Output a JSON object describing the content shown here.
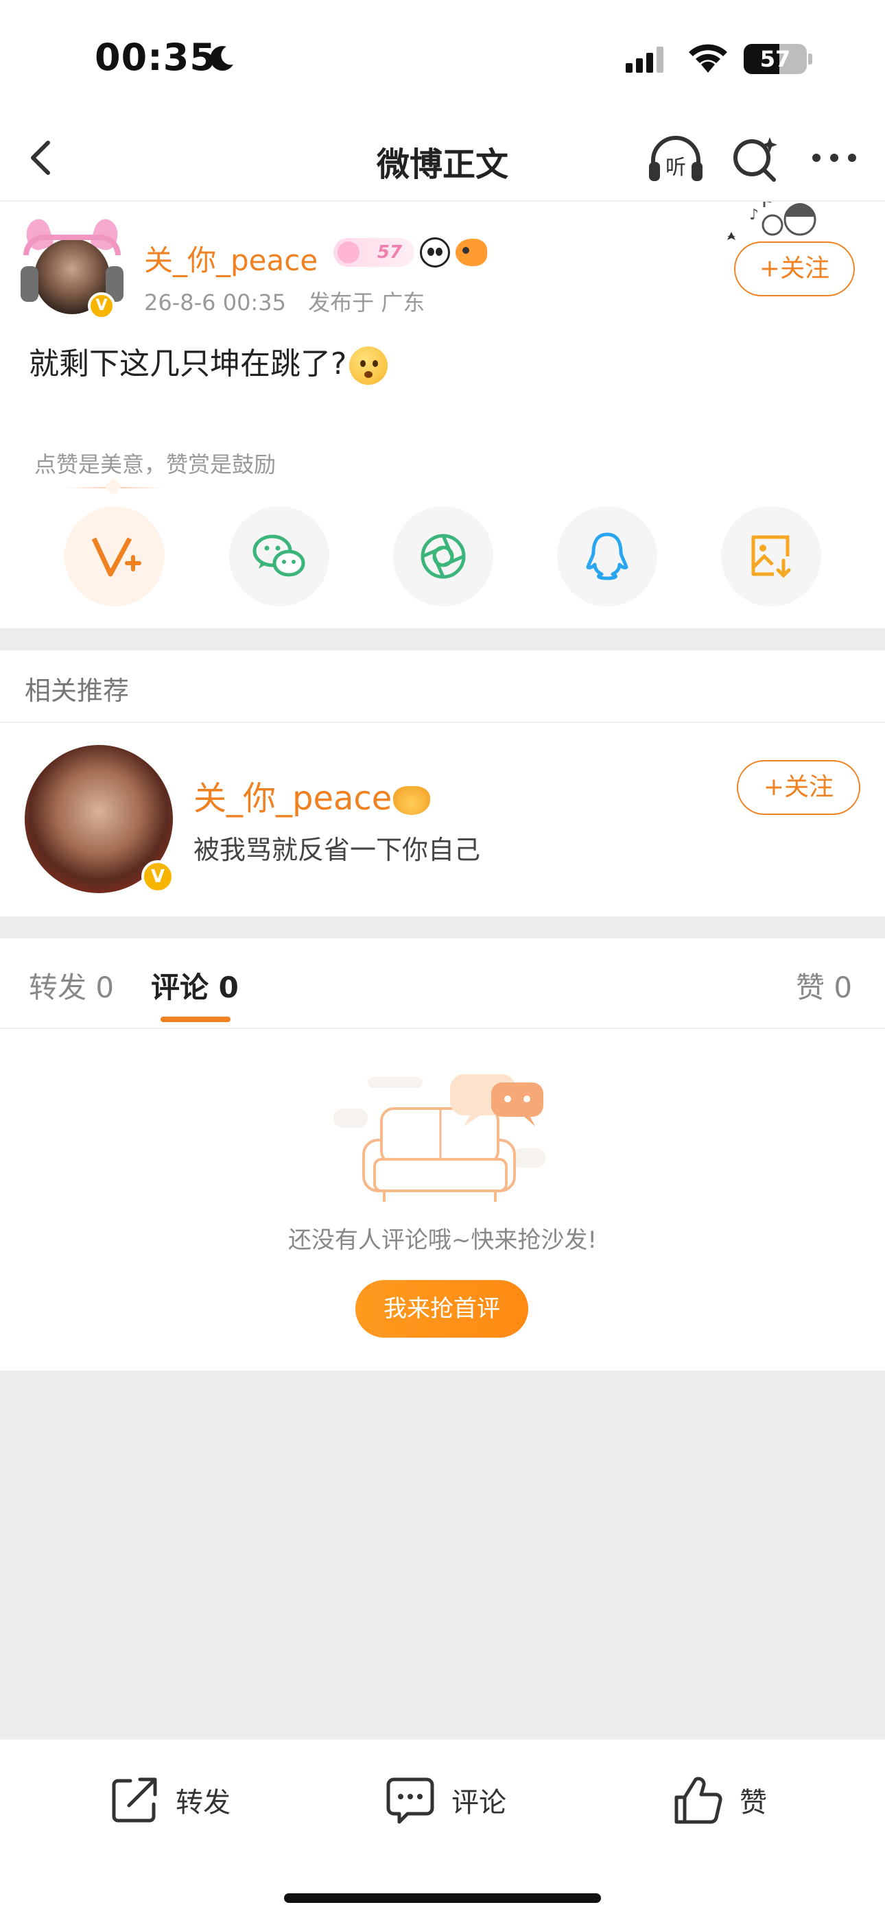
{
  "status_bar": {
    "time": "00:35",
    "battery": "57",
    "battery_level": 0.57
  },
  "nav": {
    "title": "微博正文",
    "listen_label": "听"
  },
  "post": {
    "author": "关_你_peace",
    "level": "57",
    "date": "26-8-6 00:35",
    "location": "发布于 广东",
    "follow_label": "+关注",
    "text": "就剩下这几只坤在跳了?",
    "reward_tip": "点赞是美意，赞赏是鼓励"
  },
  "share_icons": [
    "v-plus-icon",
    "wechat-icon",
    "moments-icon",
    "qq-icon",
    "save-image-icon"
  ],
  "recommend": {
    "title": "相关推荐",
    "name": "关_你_peace",
    "desc": "被我骂就反省一下你自己",
    "follow_label": "+关注"
  },
  "tabs": {
    "repost": "转发 0",
    "comment": "评论 0",
    "like": "赞 0"
  },
  "empty": {
    "text": "还没有人评论哦~快来抢沙发!",
    "button": "我来抢首评"
  },
  "bottom_bar": {
    "repost": "转发",
    "comment": "评论",
    "like": "赞"
  },
  "colors": {
    "accent": "#f08121",
    "verified": "#f7b500"
  }
}
